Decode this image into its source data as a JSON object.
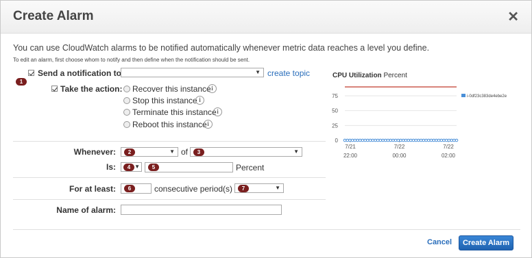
{
  "dialog": {
    "title": "Create Alarm",
    "close_glyph": "✕",
    "intro": "You can use CloudWatch alarms to be notified automatically whenever metric data reaches a level you define.",
    "subintro": "To edit an alarm, first choose whom to notify and then define when the notification should be sent."
  },
  "notification": {
    "label": "Send a notification to:",
    "checked": true,
    "value": "",
    "link": "create topic"
  },
  "action": {
    "label": "Take the action:",
    "checked": true,
    "options": [
      "Recover this instance",
      "Stop this instance",
      "Terminate this instance",
      "Reboot this instance"
    ]
  },
  "whenever": {
    "label": "Whenever:",
    "statistic": "",
    "of_text": "of",
    "metric": ""
  },
  "is": {
    "label": "Is:",
    "operator": "",
    "value": "",
    "unit": "Percent"
  },
  "for_at_least": {
    "label": "For at least:",
    "periods": "",
    "text": "consecutive period(s) of",
    "period": ""
  },
  "name": {
    "label": "Name of alarm:",
    "value": ""
  },
  "badges": {
    "b1": "1",
    "b2": "2",
    "b3": "3",
    "b4": "4",
    "b5": "5",
    "b6": "6",
    "b7": "7"
  },
  "footer": {
    "cancel": "Cancel",
    "create": "Create Alarm"
  },
  "chart_data": {
    "type": "line",
    "title": "CPU Utilization",
    "unit": "Percent",
    "y_ticks": [
      0,
      25,
      50,
      75
    ],
    "ylim": [
      0,
      90
    ],
    "x_ticks": [
      [
        "7/21",
        "22:00"
      ],
      [
        "7/22",
        "00:00"
      ],
      [
        "7/22",
        "02:00"
      ]
    ],
    "threshold": 90,
    "threshold_color": "#c0392b",
    "series": [
      {
        "name": "i-0df23c383de4ebe2e",
        "color": "#4a8fd8",
        "values": [
          0,
          0,
          0,
          0,
          0,
          0,
          0,
          0,
          0,
          0,
          0,
          0,
          0,
          0,
          0,
          0,
          0,
          0,
          0,
          0,
          0,
          0,
          0,
          0,
          0,
          0,
          0,
          0,
          0,
          0,
          0,
          0,
          0,
          0,
          0,
          0,
          0,
          0,
          0,
          0,
          0,
          0,
          0,
          0,
          0
        ]
      }
    ]
  }
}
